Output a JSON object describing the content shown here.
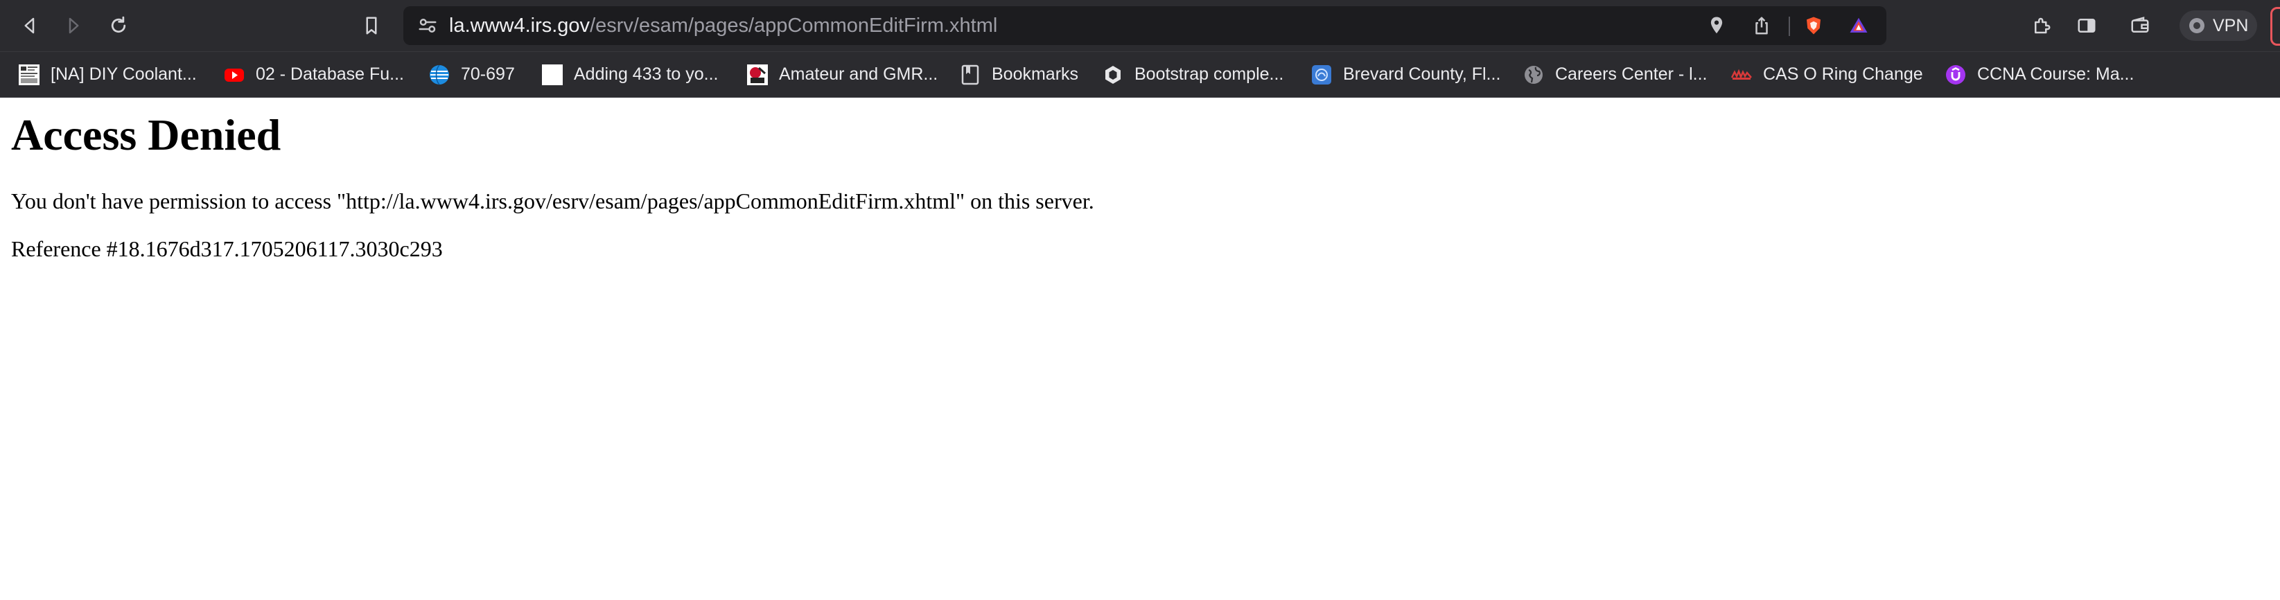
{
  "browser": {
    "url": {
      "host": "la.www4.irs.gov",
      "path": "/esrv/esam/pages/appCommonEditFirm.xhtml"
    },
    "vpn_label": "VPN",
    "bookmarks": [
      {
        "label": "[NA] DIY Coolant...",
        "icon": "page-thumbnail-icon"
      },
      {
        "label": "02 - Database Fu...",
        "icon": "youtube-icon"
      },
      {
        "label": "70-697",
        "icon": "att-globe-icon"
      },
      {
        "label": "Adding 433 to yo...",
        "icon": "blank-page-icon"
      },
      {
        "label": "Amateur and GMR...",
        "icon": "site-logo-icon"
      },
      {
        "label": "Bookmarks",
        "icon": "bookmark-folder-icon"
      },
      {
        "label": "Bootstrap comple...",
        "icon": "hexagon-icon"
      },
      {
        "label": "Brevard County, Fl...",
        "icon": "county-seal-icon"
      },
      {
        "label": "Careers Center - l...",
        "icon": "globe-icon"
      },
      {
        "label": "CAS O Ring Change",
        "icon": "cas-logo-icon"
      },
      {
        "label": "CCNA Course: Ma...",
        "icon": "udemy-icon"
      }
    ]
  },
  "page": {
    "heading": "Access Denied",
    "message": "You don't have permission to access \"http://la.www4.irs.gov/esrv/esam/pages/appCommonEditFirm.xhtml\" on this server.",
    "reference": "Reference #18.1676d317.1705206117.3030c293"
  },
  "colors": {
    "chrome_bg": "#2b2b2f",
    "urlbar_bg": "#1c1c1f",
    "page_bg": "#ffffff",
    "brave_orange": "#fb542b"
  }
}
